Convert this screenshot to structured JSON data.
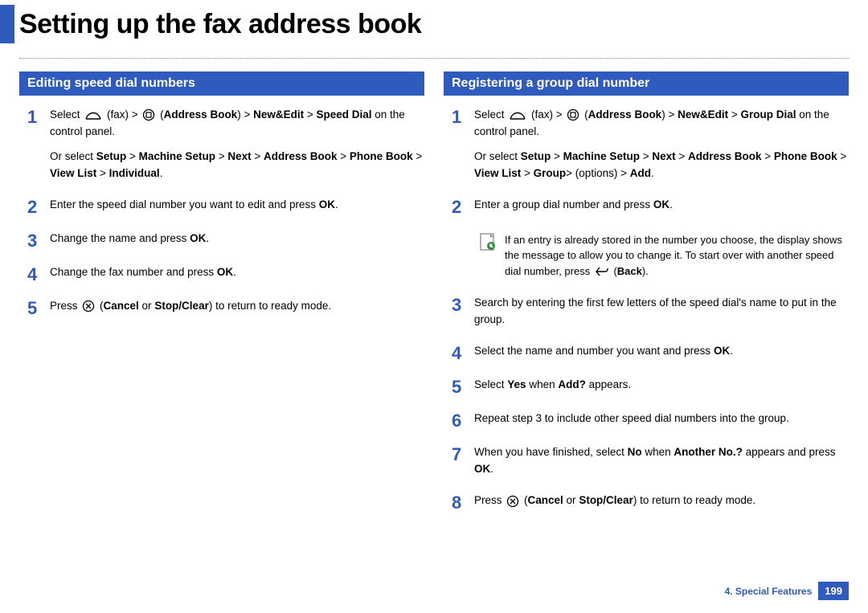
{
  "page_title": "Setting up the fax address book",
  "left": {
    "header": "Editing speed dial numbers",
    "steps": [
      {
        "num": "1",
        "html": "Select <svg class='inline-icon' width='22' height='16' viewBox='0 0 22 16'><path d='M2 13 C 5 3, 17 3, 20 13' fill='none' stroke='#000' stroke-width='1.4'/><line x1='2' y1='13' x2='20' y2='13' stroke='#000' stroke-width='1.4'/></svg> (fax) > <svg class='inline-icon' width='16' height='16' viewBox='0 0 16 16'><circle cx='8' cy='8' r='6.5' fill='none' stroke='#000' stroke-width='1.3'/><rect x='5' y='5' width='6' height='6' fill='none' stroke='#000' stroke-width='1.2'/></svg> (<b>Address Book</b>) > <b>New&Edit</b> > <b>Speed Dial</b> on the control panel.",
        "alt_html": "Or select <b>Setup</b> > <b>Machine Setup</b> > <b>Next</b> > <b>Address Book</b> > <b>Phone Book</b> > <b>View List</b> > <b>Individual</b>."
      },
      {
        "num": "2",
        "html": "Enter the speed dial number you want to edit and press <b>OK</b>."
      },
      {
        "num": "3",
        "html": "Change the name and press <b>OK</b>."
      },
      {
        "num": "4",
        "html": "Change the fax number and press <b>OK</b>."
      },
      {
        "num": "5",
        "html": "Press <svg class='inline-icon' width='16' height='16' viewBox='0 0 16 16'><circle cx='8' cy='8' r='6.5' fill='none' stroke='#000' stroke-width='1.3'/><line x1='5' y1='5' x2='11' y2='11' stroke='#000' stroke-width='1.3'/><line x1='11' y1='5' x2='5' y2='11' stroke='#000' stroke-width='1.3'/></svg> (<b>Cancel</b> or <b>Stop/Clear</b>) to return to ready mode."
      }
    ]
  },
  "right": {
    "header": "Registering a group dial number",
    "steps_top": [
      {
        "num": "1",
        "html": "Select <svg class='inline-icon' width='22' height='16' viewBox='0 0 22 16'><path d='M2 13 C 5 3, 17 3, 20 13' fill='none' stroke='#000' stroke-width='1.4'/><line x1='2' y1='13' x2='20' y2='13' stroke='#000' stroke-width='1.4'/></svg> (fax) > <svg class='inline-icon' width='16' height='16' viewBox='0 0 16 16'><circle cx='8' cy='8' r='6.5' fill='none' stroke='#000' stroke-width='1.3'/><rect x='5' y='5' width='6' height='6' fill='none' stroke='#000' stroke-width='1.2'/></svg> (<b>Address Book</b>) > <b>New&Edit</b> > <b>Group Dial</b> on the control panel.",
        "alt_html": "Or select <b>Setup</b> > <b>Machine Setup</b> > <b>Next</b> > <b>Address Book</b> > <b>Phone Book</b> > <b>View List</b> > <b>Group</b>> (options) > <b>Add</b>."
      },
      {
        "num": "2",
        "html": "Enter a group dial number and press <b>OK</b>."
      }
    ],
    "note_html": "If an entry is already stored in the number you choose, the display shows the message to allow you to change it. To start over with another speed dial number, press <svg class='inline-icon' width='18' height='14' viewBox='0 0 18 14'><path d='M6 2 L2 7 L6 12' fill='none' stroke='#000' stroke-width='1.4'/><path d='M2 7 H13 A3 3 0 0 0 16 4 V3' fill='none' stroke='#000' stroke-width='1.4'/></svg> (<b>Back</b>).",
    "steps_bottom": [
      {
        "num": "3",
        "html": "Search by entering the first few letters of the speed dial's name to put in the group."
      },
      {
        "num": "4",
        "html": "Select the name and number you want and press <b>OK</b>."
      },
      {
        "num": "5",
        "html": "Select <b>Yes</b> when <b>Add?</b> appears."
      },
      {
        "num": "6",
        "html": "Repeat step 3 to include other speed dial numbers into the group."
      },
      {
        "num": "7",
        "html": "When you have finished, select <b>No</b> when <b>Another No.?</b> appears and press <b>OK</b>."
      },
      {
        "num": "8",
        "html": "Press <svg class='inline-icon' width='16' height='16' viewBox='0 0 16 16'><circle cx='8' cy='8' r='6.5' fill='none' stroke='#000' stroke-width='1.3'/><line x1='5' y1='5' x2='11' y2='11' stroke='#000' stroke-width='1.3'/><line x1='11' y1='5' x2='5' y2='11' stroke='#000' stroke-width='1.3'/></svg> (<b>Cancel</b> or <b>Stop/Clear</b>) to return to ready mode."
      }
    ]
  },
  "footer": {
    "chapter": "4.  Special Features",
    "page": "199"
  }
}
